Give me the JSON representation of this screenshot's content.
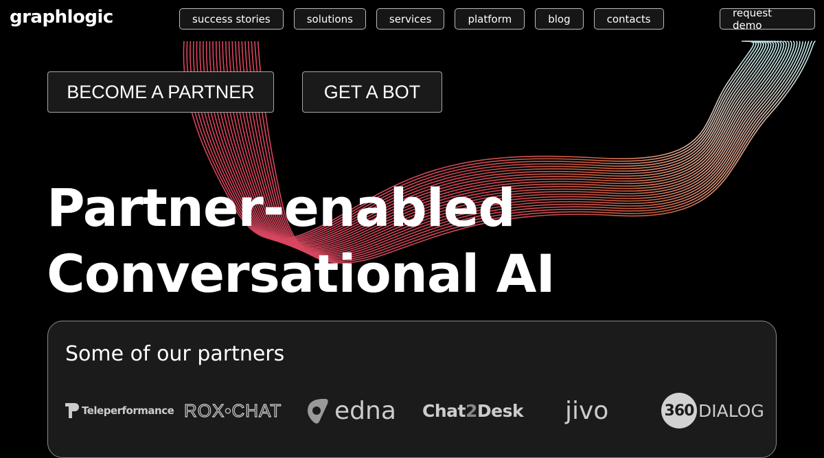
{
  "header": {
    "logo": "graphlogic",
    "nav": [
      {
        "label": "success stories"
      },
      {
        "label": "solutions"
      },
      {
        "label": "services"
      },
      {
        "label": "platform"
      },
      {
        "label": "blog"
      },
      {
        "label": "contacts"
      }
    ],
    "request_demo": "request demo"
  },
  "hero": {
    "cta_partner": "BECOME A PARTNER",
    "cta_bot": "GET A BOT",
    "headline_line1": "Partner-enabled",
    "headline_line2": "Conversational AI"
  },
  "partners": {
    "title": "Some of our partners",
    "logos": [
      {
        "name": "Teleperformance",
        "icon": "teleperformance-logo-icon"
      },
      {
        "name": "ROX•CHAT"
      },
      {
        "name": "edna",
        "icon": "edna-logo-icon"
      },
      {
        "name_a": "Chat",
        "name_b": "2",
        "name_c": "Desk"
      },
      {
        "name": "jivo"
      },
      {
        "circle": "360",
        "name": "DIALOG"
      }
    ]
  },
  "colors": {
    "background": "#000000",
    "button_bg": "#161616",
    "wave_red": "#d8455f",
    "wave_orange": "#d8673f",
    "wave_light": "#bfe3e6"
  }
}
